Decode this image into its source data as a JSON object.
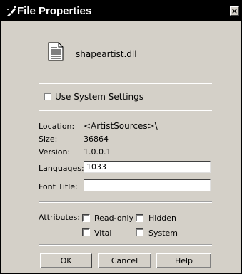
{
  "window": {
    "title": "File Properties",
    "close_glyph": "×"
  },
  "file": {
    "name": "shapeartist.dll",
    "icon": "document-icon"
  },
  "use_system_settings": {
    "label": "Use System Settings",
    "checked": false
  },
  "info": {
    "location_label": "Location:",
    "location_value": "<ArtistSources>\\",
    "size_label": "Size:",
    "size_value": "36864",
    "version_label": "Version:",
    "version_value": "1.0.0.1"
  },
  "languages": {
    "label": "Languages:",
    "value": "1033"
  },
  "font_title": {
    "label": "Font Title:",
    "value": ""
  },
  "attributes": {
    "label": "Attributes:",
    "read_only": {
      "label": "Read-only",
      "checked": false
    },
    "hidden": {
      "label": "Hidden",
      "checked": false
    },
    "vital": {
      "label": "Vital",
      "checked": false
    },
    "system": {
      "label": "System",
      "checked": false
    }
  },
  "buttons": {
    "ok": "OK",
    "cancel": "Cancel",
    "help": "Help"
  }
}
